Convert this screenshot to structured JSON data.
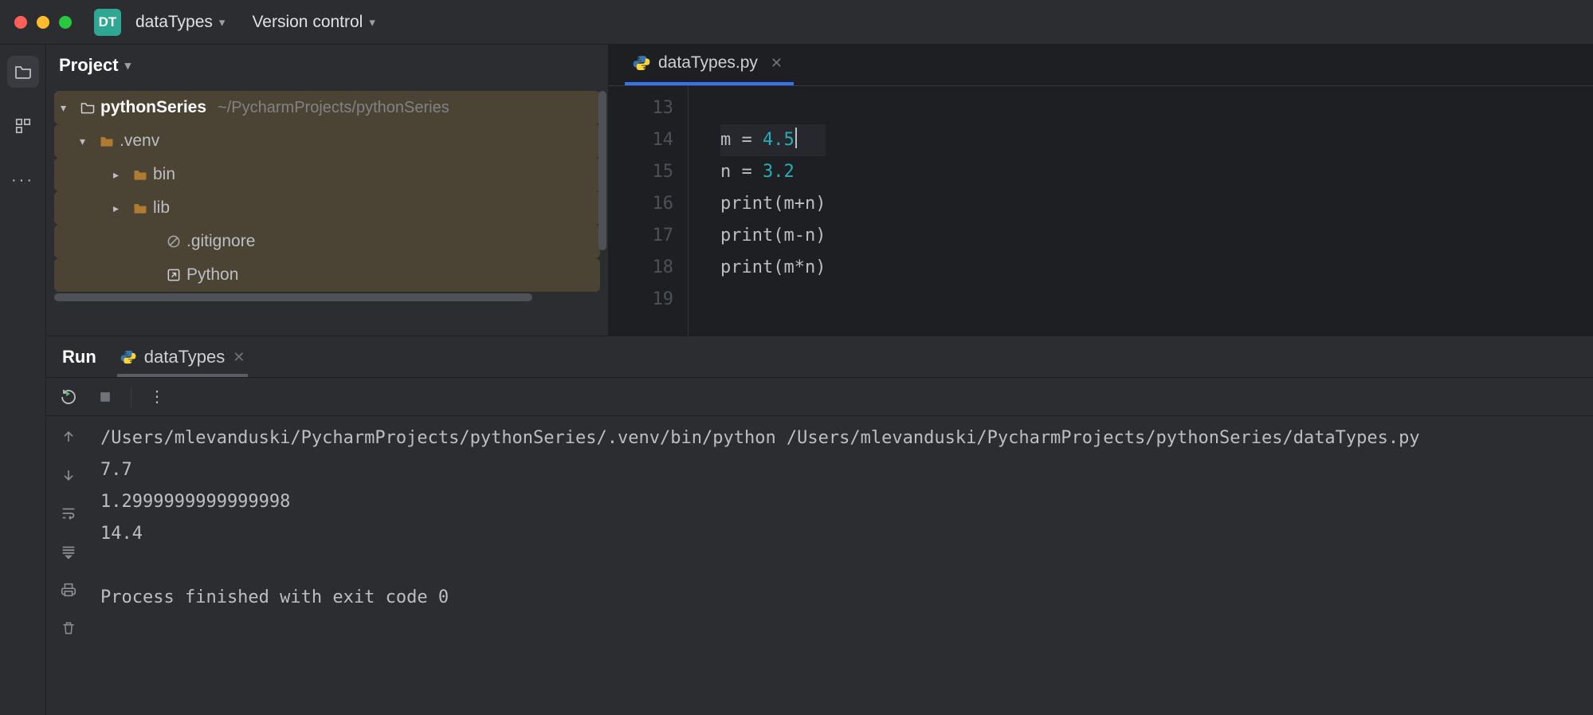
{
  "titlebar": {
    "badge_text": "DT",
    "project_name": "dataTypes",
    "vcs_label": "Version control"
  },
  "project_panel": {
    "title": "Project",
    "root": {
      "name": "pythonSeries",
      "path": "~/PycharmProjects/pythonSeries"
    },
    "items": [
      {
        "name": ".venv",
        "kind": "folder",
        "expanded": true
      },
      {
        "name": "bin",
        "kind": "folder",
        "expanded": false
      },
      {
        "name": "lib",
        "kind": "folder",
        "expanded": false
      },
      {
        "name": ".gitignore",
        "kind": "ignore"
      },
      {
        "name": "Python",
        "kind": "shortcut"
      }
    ]
  },
  "editor": {
    "tab": {
      "filename": "dataTypes.py"
    },
    "first_line_no": 13,
    "lines": [
      {
        "no": 13,
        "text": ""
      },
      {
        "no": 14,
        "text_var": "m",
        "assign": "4.5",
        "current": true
      },
      {
        "no": 15,
        "text_var": "n",
        "assign": "3.2"
      },
      {
        "no": 16,
        "print_expr": "m+n"
      },
      {
        "no": 17,
        "print_expr": "m-n"
      },
      {
        "no": 18,
        "print_expr": "m*n"
      },
      {
        "no": 19,
        "text": ""
      }
    ]
  },
  "run_panel": {
    "label": "Run",
    "config_name": "dataTypes",
    "output": [
      "/Users/mlevanduski/PycharmProjects/pythonSeries/.venv/bin/python /Users/mlevanduski/PycharmProjects/pythonSeries/dataTypes.py",
      "7.7",
      "1.2999999999999998",
      "14.4",
      "",
      "Process finished with exit code 0"
    ]
  }
}
